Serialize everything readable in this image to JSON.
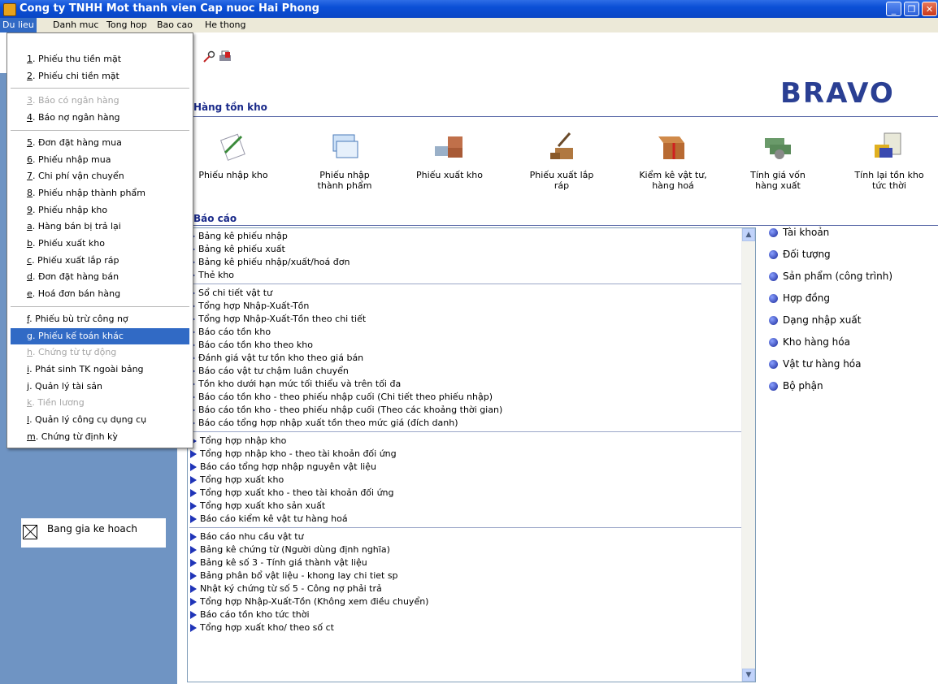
{
  "window": {
    "title": "Cong ty TNHH Mot thanh vien Cap nuoc Hai Phong"
  },
  "menubar": [
    "Du lieu",
    "Danh muc",
    "Tong hop",
    "Bao cao",
    "He thong"
  ],
  "brand": "BRAVO",
  "section_inventory": "Hàng tồn kho",
  "big_icons": [
    {
      "label": "Phiếu nhập kho",
      "icon": "pen-document-icon"
    },
    {
      "label": "Phiếu nhập thành phẩm",
      "icon": "forms-icon"
    },
    {
      "label": "Phiếu xuất kho",
      "icon": "truck-boxes-icon"
    },
    {
      "label": "Phiếu xuất lắp ráp",
      "icon": "hammer-boxes-icon"
    },
    {
      "label": "Kiểm kê vật tư, hàng hoá",
      "icon": "open-box-icon"
    },
    {
      "label": "Tính giá vốn hàng xuất",
      "icon": "money-stack-icon"
    },
    {
      "label": "Tính lại tồn kho tức thời",
      "icon": "calculator-icon"
    }
  ],
  "section_reports": "Báo cáo",
  "report_groups": [
    [
      "Bảng kê phiếu nhập",
      "Bảng kê phiếu xuất",
      "Bảng kê phiếu nhập/xuất/hoá đơn",
      "Thẻ kho"
    ],
    [
      "Sổ chi tiết vật tư",
      "Tổng hợp Nhập-Xuất-Tồn",
      "Tổng hợp Nhập-Xuất-Tồn theo chi tiết",
      "Báo cáo tồn kho",
      "Báo cáo tồn kho theo kho",
      "Đánh giá vật tư tồn kho theo giá bán",
      "Báo cáo vật tư chậm luân chuyển",
      "Tồn kho dưới hạn mức tối thiểu và trên tối đa",
      "Báo cáo tồn kho - theo phiếu nhập cuối (Chi tiết theo phiếu nhập)",
      "Báo cáo tồn kho - theo phiếu nhập cuối (Theo các khoảng thời gian)",
      "Báo cáo tổng hợp nhập xuất tồn theo mức giá (đích danh)"
    ],
    [
      "Tổng hợp nhập kho",
      "Tổng hợp nhập kho - theo tài khoản đối ứng",
      "Báo cáo tổng hợp nhập nguyên vật liệu",
      "Tổng hợp xuất kho",
      "Tổng hợp xuất kho - theo tài khoản đối ứng",
      "Tổng hợp xuất kho sản xuất",
      "Báo cáo kiểm kê vật tư hàng hoá"
    ],
    [
      "Báo cáo nhu cầu vật tư",
      "Bảng kê chứng từ (Người dùng định nghĩa)",
      "Bảng kê số 3 - Tính giá thành vật liệu",
      "Bảng phân bổ vật liệu - khong lay chi tiet sp",
      "Nhật ký chứng từ số 5 - Công nợ phải trả",
      "Tổng hợp Nhập-Xuất-Tồn (Không xem điều chuyển)",
      "Báo cáo tồn kho tức thời",
      "Tổng hợp xuất kho/ theo số ct"
    ]
  ],
  "catalog": [
    "Tài khoản",
    "Đối tượng",
    "Sản phẩm (công trình)",
    "Hợp đồng",
    "Dạng nhập xuất",
    "Kho hàng hóa",
    "Vật tư hàng hóa",
    "Bộ phận"
  ],
  "left_panel_item": "Bang gia ke hoach",
  "dropdown": [
    {
      "key": "1",
      "label": ". Phiếu thu tiền mặt"
    },
    {
      "key": "2",
      "label": ". Phiếu chi tiền mặt"
    },
    {
      "sep": true
    },
    {
      "key": "3",
      "label": ". Báo có ngân hàng",
      "disabled": true
    },
    {
      "key": "4",
      "label": ". Báo nợ ngân hàng"
    },
    {
      "sep": true
    },
    {
      "key": "5",
      "label": ". Đơn đặt hàng mua"
    },
    {
      "key": "6",
      "label": ". Phiếu nhập mua"
    },
    {
      "key": "7",
      "label": ". Chi phí vận chuyển"
    },
    {
      "key": "8",
      "label": ". Phiếu nhập thành phẩm"
    },
    {
      "key": "9",
      "label": ". Phiếu nhập kho"
    },
    {
      "key": "a",
      "label": ". Hàng bán bị trả lại"
    },
    {
      "key": "b",
      "label": ". Phiếu xuất kho"
    },
    {
      "key": "c",
      "label": ". Phiếu xuất lắp ráp"
    },
    {
      "key": "d",
      "label": ". Đơn đặt hàng bán"
    },
    {
      "key": "e",
      "label": ". Hoá đơn bán hàng"
    },
    {
      "sep": true
    },
    {
      "key": "f",
      "label": ". Phiếu bù trừ công nợ"
    },
    {
      "key": "g",
      "label": ". Phiếu kế toán khác",
      "selected": true
    },
    {
      "key": "h",
      "label": ". Chứng từ tự động",
      "disabled": true
    },
    {
      "key": "i",
      "label": ". Phát sinh TK ngoài bảng"
    },
    {
      "key": "j",
      "label": ". Quản lý tài sản"
    },
    {
      "key": "k",
      "label": ". Tiền lương",
      "disabled": true
    },
    {
      "key": "l",
      "label": ". Quản lý công cụ dụng cụ"
    },
    {
      "key": "m",
      "label": ". Chứng từ định kỳ"
    }
  ]
}
